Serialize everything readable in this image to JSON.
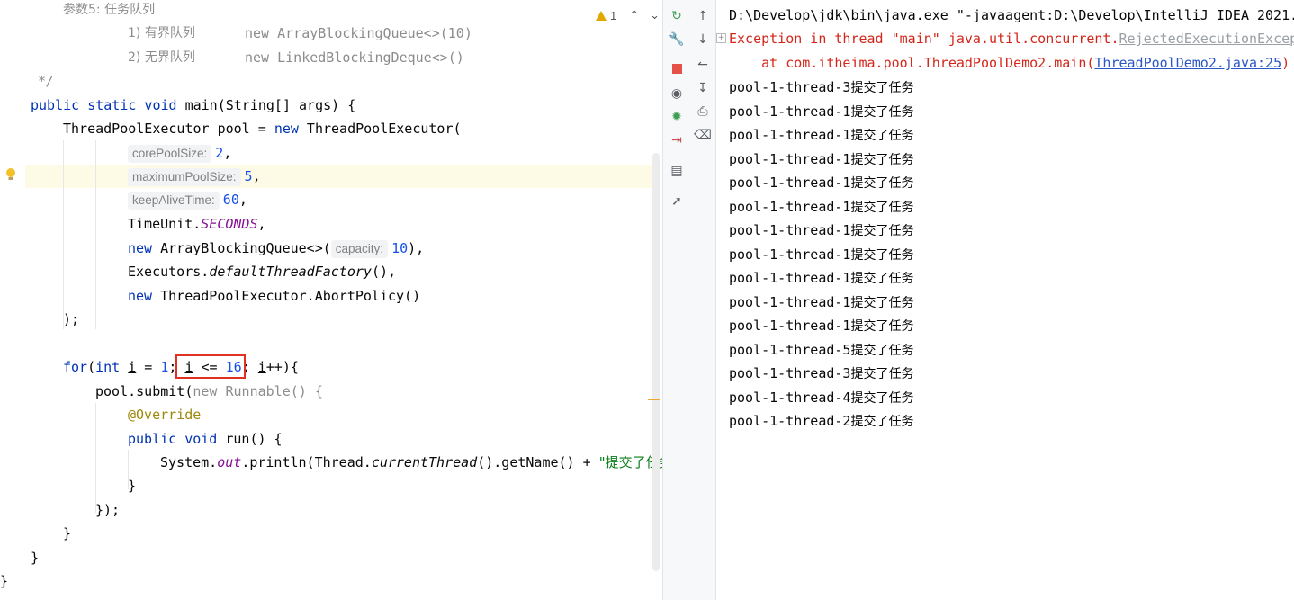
{
  "editor": {
    "warning_count": "1",
    "comment": {
      "param5": "参数5: 任务队列",
      "bounded_label": "1) 有界队列",
      "bounded_value": "new ArrayBlockingQueue<>(10)",
      "unbounded_label": "2) 无界队列",
      "unbounded_value": "new LinkedBlockingDeque<>()",
      "end": "*/"
    },
    "code": {
      "public_static_void": "public static void ",
      "main_sig": "main(String[] args) {",
      "pool_decl": "ThreadPoolExecutor pool = ",
      "kw_new": "new",
      "tpe_open": " ThreadPoolExecutor(",
      "hint_core": "corePoolSize:",
      "core_val": "2",
      "hint_max": "maximumPoolSize:",
      "max_val": "5",
      "hint_keep": "keepAliveTime:",
      "keep_val": "60",
      "timeunit": "TimeUnit.",
      "seconds": "SECONDS",
      "abq": " ArrayBlockingQueue<>(",
      "hint_capacity": "capacity:",
      "capacity_val": "10",
      "executors": "Executors.",
      "dtf": "defaultThreadFactory",
      "abort": " ThreadPoolExecutor.AbortPolicy()",
      "close_paren": ");",
      "for_kw": "for",
      "int_kw": "int",
      "loop_i": "i",
      "loop_cond_op": " <= ",
      "loop_max": "16",
      "submit": "pool.submit(",
      "new_runnable": "new Runnable() {",
      "override": "@Override",
      "public_void": "public void ",
      "run_sig": "run() {",
      "sysout_a": "System.",
      "sysout_out": "out",
      "sysout_b": ".println(Thread.",
      "current_thread": "currentThread",
      "sysout_c": "().getName() + ",
      "string_lit": "\"提交了任务",
      "close_brace": "}",
      "close_inner": "});"
    }
  },
  "console": {
    "cmd_line": "D:\\Develop\\jdk\\bin\\java.exe \"-javaagent:D:\\Develop\\IntelliJ IDEA 2021.",
    "exception_prefix": "Exception in thread \"main\" java.util.concurrent.",
    "exception_class": "RejectedExecutionExcep",
    "at_prefix": "    at com.itheima.pool.ThreadPoolDemo2.main(",
    "at_link": "ThreadPoolDemo2.java:25",
    "at_suffix": ")",
    "output": [
      {
        "thread": "pool-1-thread-3",
        "msg": "提交了任务"
      },
      {
        "thread": "pool-1-thread-1",
        "msg": "提交了任务"
      },
      {
        "thread": "pool-1-thread-1",
        "msg": "提交了任务"
      },
      {
        "thread": "pool-1-thread-1",
        "msg": "提交了任务"
      },
      {
        "thread": "pool-1-thread-1",
        "msg": "提交了任务"
      },
      {
        "thread": "pool-1-thread-1",
        "msg": "提交了任务"
      },
      {
        "thread": "pool-1-thread-1",
        "msg": "提交了任务"
      },
      {
        "thread": "pool-1-thread-1",
        "msg": "提交了任务"
      },
      {
        "thread": "pool-1-thread-1",
        "msg": "提交了任务"
      },
      {
        "thread": "pool-1-thread-1",
        "msg": "提交了任务"
      },
      {
        "thread": "pool-1-thread-1",
        "msg": "提交了任务"
      },
      {
        "thread": "pool-1-thread-5",
        "msg": "提交了任务"
      },
      {
        "thread": "pool-1-thread-3",
        "msg": "提交了任务"
      },
      {
        "thread": "pool-1-thread-4",
        "msg": "提交了任务"
      },
      {
        "thread": "pool-1-thread-2",
        "msg": "提交了任务"
      }
    ]
  },
  "toolbar": {
    "icons": [
      "rerun-icon",
      "wrench-icon",
      "stop-icon",
      "camera-icon",
      "debug-bug-icon",
      "exit-icon",
      "layout-icon",
      "pin-icon",
      "scroll-up-icon",
      "scroll-down-icon",
      "soft-wrap-icon",
      "scroll-to-end-icon",
      "print-icon",
      "trash-icon"
    ]
  },
  "colors": {
    "keyword": "#0033b3",
    "number": "#1750eb",
    "string": "#067d17",
    "error": "#d4261a",
    "link": "#2a57c6",
    "highlight_box": "#e03222"
  }
}
